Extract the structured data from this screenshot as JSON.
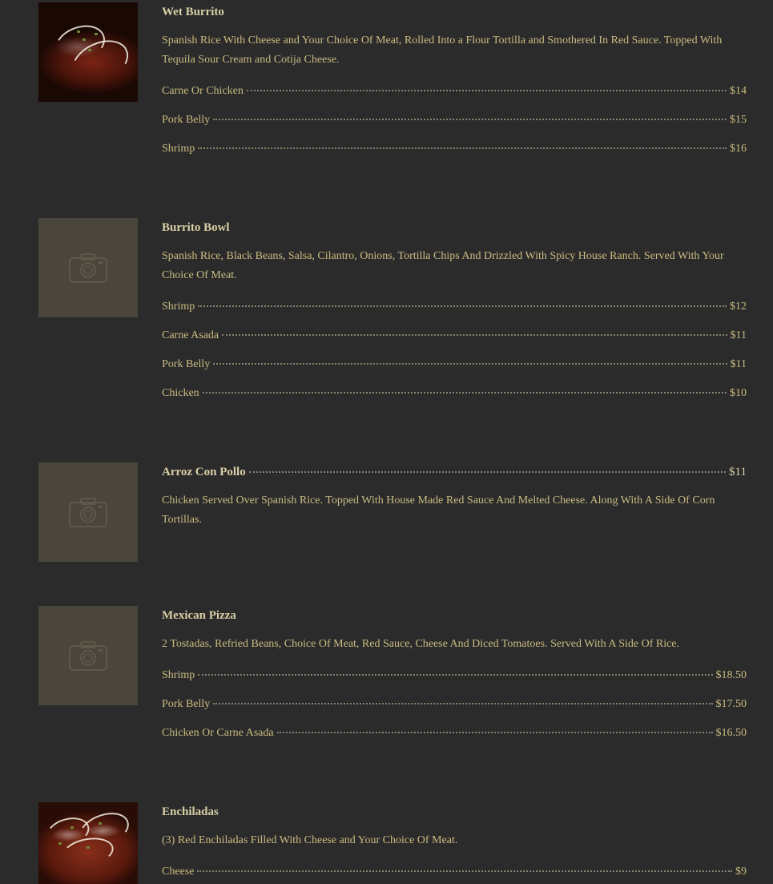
{
  "items": [
    {
      "name": "Wet Burrito",
      "description": "Spanish Rice With Cheese and Your Choice Of Meat, Rolled Into a Flour Tortilla and Smothered In Red Sauce. Topped With Tequila Sour Cream and Cotija Cheese.",
      "image": "photo-burrito",
      "options": [
        {
          "label": "Carne Or Chicken",
          "price": "$14"
        },
        {
          "label": "Pork Belly",
          "price": "$15"
        },
        {
          "label": "Shrimp",
          "price": "$16"
        }
      ]
    },
    {
      "name": "Burrito Bowl",
      "description": "Spanish Rice, Black Beans, Salsa, Cilantro, Onions, Tortilla Chips And Drizzled With Spicy House Ranch. Served With Your Choice Of Meat.",
      "image": "camera-icon",
      "options": [
        {
          "label": "Shrimp",
          "price": "$12"
        },
        {
          "label": "Carne Asada",
          "price": "$11"
        },
        {
          "label": "Pork Belly",
          "price": "$11"
        },
        {
          "label": "Chicken",
          "price": "$10"
        }
      ]
    },
    {
      "name": "Arroz Con Pollo",
      "price": "$11",
      "description": "Chicken Served Over Spanish Rice. Topped With House Made Red Sauce And Melted Cheese. Along With A Side Of Corn Tortillas.",
      "image": "camera-icon"
    },
    {
      "name": "Mexican Pizza",
      "description": "2 Tostadas, Refried Beans, Choice Of Meat, Red Sauce, Cheese And Diced Tomatoes. Served With A Side Of Rice.",
      "image": "camera-icon",
      "options": [
        {
          "label": "Shrimp",
          "price": "$18.50"
        },
        {
          "label": "Pork Belly",
          "price": "$17.50"
        },
        {
          "label": "Chicken Or Carne Asada",
          "price": "$16.50"
        }
      ]
    },
    {
      "name": "Enchiladas",
      "description": "(3) Red Enchiladas Filled With Cheese and Your Choice Of Meat.",
      "image": "photo-enchiladas",
      "options": [
        {
          "label": "Cheese",
          "price": "$9"
        }
      ]
    }
  ]
}
